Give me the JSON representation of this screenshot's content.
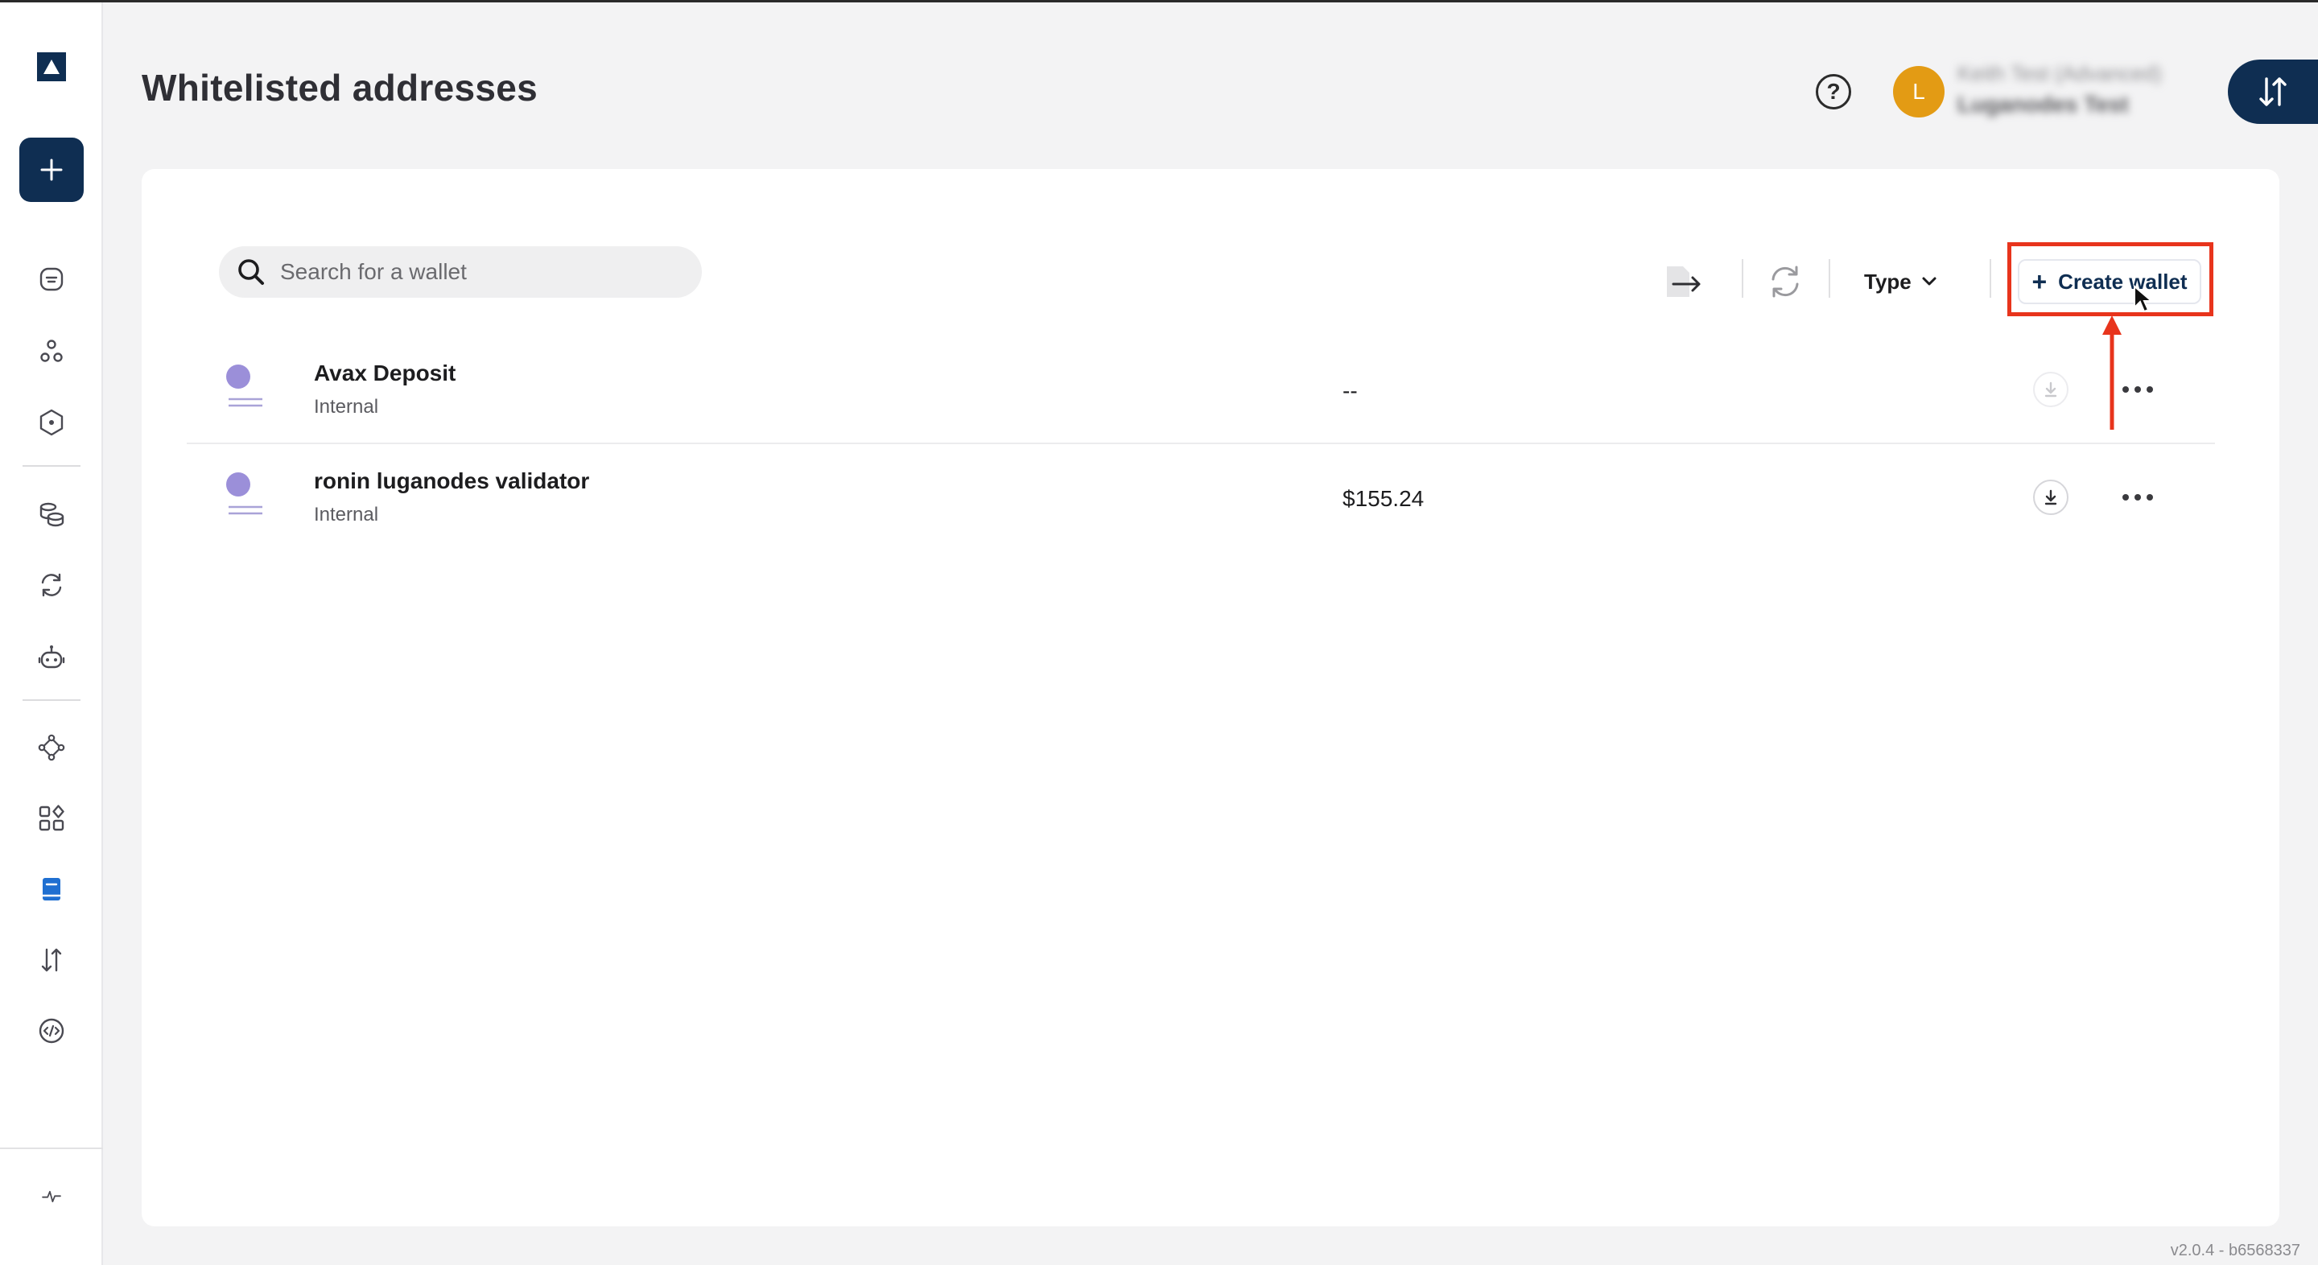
{
  "page": {
    "title": "Whitelisted addresses",
    "version": "v2.0.4 - b6568337"
  },
  "header": {
    "help_icon": "help-circle-icon",
    "user": {
      "initial": "L",
      "name": "Keith Test (Advanced)",
      "org": "Luganodes Test"
    }
  },
  "sidebar": {
    "logo_icon": "triangle-logo-icon",
    "new_button_icon": "plus-icon",
    "items": [
      {
        "name": "dashboard",
        "icon": "dashboard-icon"
      },
      {
        "name": "users",
        "icon": "users-icon"
      },
      {
        "name": "security",
        "icon": "shield-hex-icon"
      },
      {
        "name": "assets",
        "icon": "coins-icon"
      },
      {
        "name": "sync",
        "icon": "refresh-icon"
      },
      {
        "name": "bots",
        "icon": "robot-icon"
      },
      {
        "name": "network",
        "icon": "nodes-icon"
      },
      {
        "name": "apps",
        "icon": "apps-grid-icon"
      },
      {
        "name": "address-book",
        "icon": "book-icon",
        "active": true
      },
      {
        "name": "transfers",
        "icon": "transfer-icon"
      },
      {
        "name": "developer",
        "icon": "code-icon"
      },
      {
        "name": "status",
        "icon": "pulse-icon"
      }
    ]
  },
  "toolbar": {
    "search_placeholder": "Search for a wallet",
    "type_filter_label": "Type",
    "create_wallet_label": "Create wallet",
    "create_wallet_prefix": "+"
  },
  "wallets": [
    {
      "name": "Avax Deposit",
      "type": "Internal",
      "balance": "--"
    },
    {
      "name": "ronin luganodes validator",
      "type": "Internal",
      "balance": "$155.24"
    }
  ],
  "colors": {
    "brand": "#0f2e52",
    "accent_highlight": "#e8341c",
    "wallet_dot": "#9b8fd9",
    "avatar": "#e39b14"
  }
}
